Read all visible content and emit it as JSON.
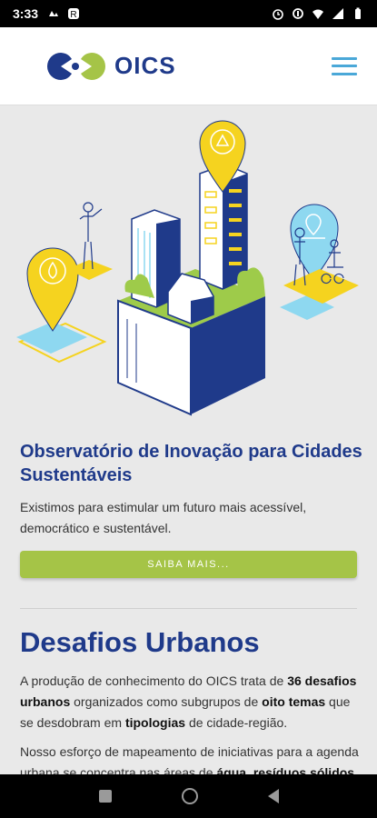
{
  "status_bar": {
    "time": "3:33"
  },
  "header": {
    "logo_text": "OICS",
    "logo_colors": {
      "dark": "#1f3a8a",
      "green": "#a5c447"
    }
  },
  "hero": {
    "title": "Observatório de Inovação para Cidades Sustentáveis",
    "description": "Existimos para estimular um futuro mais acessível, democrático e sustentável.",
    "cta_label": "SAIBA MAIS..."
  },
  "section": {
    "title": "Desafios Urbanos",
    "p1": {
      "t1": "A produção de conhecimento do OICS trata de ",
      "b1": "36 desafios urbanos",
      "t2": " organizados como subgrupos de ",
      "b2": "oito temas",
      "t3": " que se desdobram em ",
      "b3": "tipologias",
      "t4": " de cidade-região."
    },
    "p2": {
      "t1": "Nosso esforço de mapeamento de iniciativas para a agenda urbana se concentra nas áreas de ",
      "b1": "água, resíduos sólidos,"
    }
  },
  "colors": {
    "accent_blue": "#1f3a8a",
    "accent_green": "#a5c447",
    "accent_yellow": "#f5d31f",
    "accent_cyan": "#8ed8f0"
  }
}
